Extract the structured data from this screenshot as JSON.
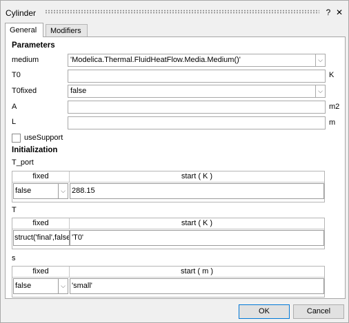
{
  "window": {
    "title": "Cylinder",
    "help_glyph": "?",
    "close_glyph": "✕"
  },
  "tabs": [
    {
      "label": "General"
    },
    {
      "label": "Modifiers"
    }
  ],
  "parameters": {
    "heading": "Parameters",
    "medium": {
      "label": "medium",
      "value": "'Modelica.Thermal.FluidHeatFlow.Media.Medium()'"
    },
    "T0": {
      "label": "T0",
      "value": "",
      "unit": "K"
    },
    "T0fixed": {
      "label": "T0fixed",
      "value": "false"
    },
    "A": {
      "label": "A",
      "value": "",
      "unit": "m2"
    },
    "L": {
      "label": "L",
      "value": "",
      "unit": "m"
    },
    "useSupport": {
      "label": "useSupport",
      "checked": false
    }
  },
  "initialization": {
    "heading": "Initialization",
    "T_port": {
      "label": "T_port",
      "col_fixed": "fixed",
      "col_start": "start ( K )",
      "fixed": "false",
      "start": "288.15"
    },
    "T": {
      "label": "T",
      "col_fixed": "fixed",
      "col_start": "start ( K )",
      "fixed": "struct('final',false",
      "start": "'T0'"
    },
    "s": {
      "label": "s",
      "col_fixed": "fixed",
      "col_start": "start ( m )",
      "fixed": "false",
      "start": "'small'"
    }
  },
  "buttons": {
    "ok": "OK",
    "cancel": "Cancel"
  },
  "icons": {
    "dropdown": "chevron-down-icon",
    "help": "help-icon",
    "close": "close-icon"
  }
}
